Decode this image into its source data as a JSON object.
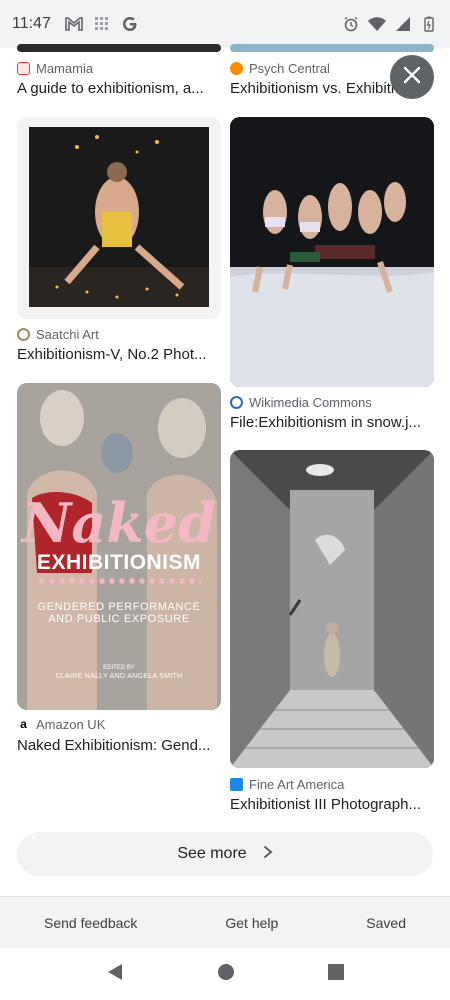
{
  "status_bar": {
    "time": "11:47",
    "left_icons": [
      "gmail-icon",
      "grid-icon",
      "google-g-icon"
    ],
    "right_icons": [
      "alarm-icon",
      "wifi-icon",
      "cell-signal-icon",
      "battery-icon"
    ]
  },
  "results": [
    {
      "source": "Mamamia",
      "title": "A guide to exhibitionism, a...",
      "source_color": "#e53935"
    },
    {
      "source": "Psych Central",
      "title": "Exhibitionism vs. Exhibitio...",
      "source_color": "#fb8c00"
    },
    {
      "source": "Saatchi Art",
      "title": "Exhibitionism-V, No.2 Phot...",
      "source_color": "#9e8a5a"
    },
    {
      "source": "Wikimedia Commons",
      "title": "File:Exhibitionism in snow.j...",
      "source_color": "#3366cc"
    },
    {
      "source": "Amazon UK",
      "title": "Naked Exhibitionism: Gend...",
      "source_color": "#000000"
    },
    {
      "source": "Fine Art America",
      "title": "Exhibitionist III Photograph...",
      "source_color": "#1e88e5"
    }
  ],
  "book_cover": {
    "title_line1": "Naked",
    "title_line2": "EXHIBITIONISM",
    "subtitle_line1": "GENDERED PERFORMANCE",
    "subtitle_line2": "AND PUBLIC EXPOSURE",
    "edited_by": "EDITED BY",
    "editors": "CLAIRE NALLY AND ANGELA SMITH"
  },
  "see_more_label": "See more",
  "footer": {
    "feedback": "Send feedback",
    "help": "Get help",
    "saved": "Saved"
  },
  "colors": {
    "accent_bg": "#f1f3f4",
    "text": "#202124",
    "muted": "#5f6368"
  }
}
